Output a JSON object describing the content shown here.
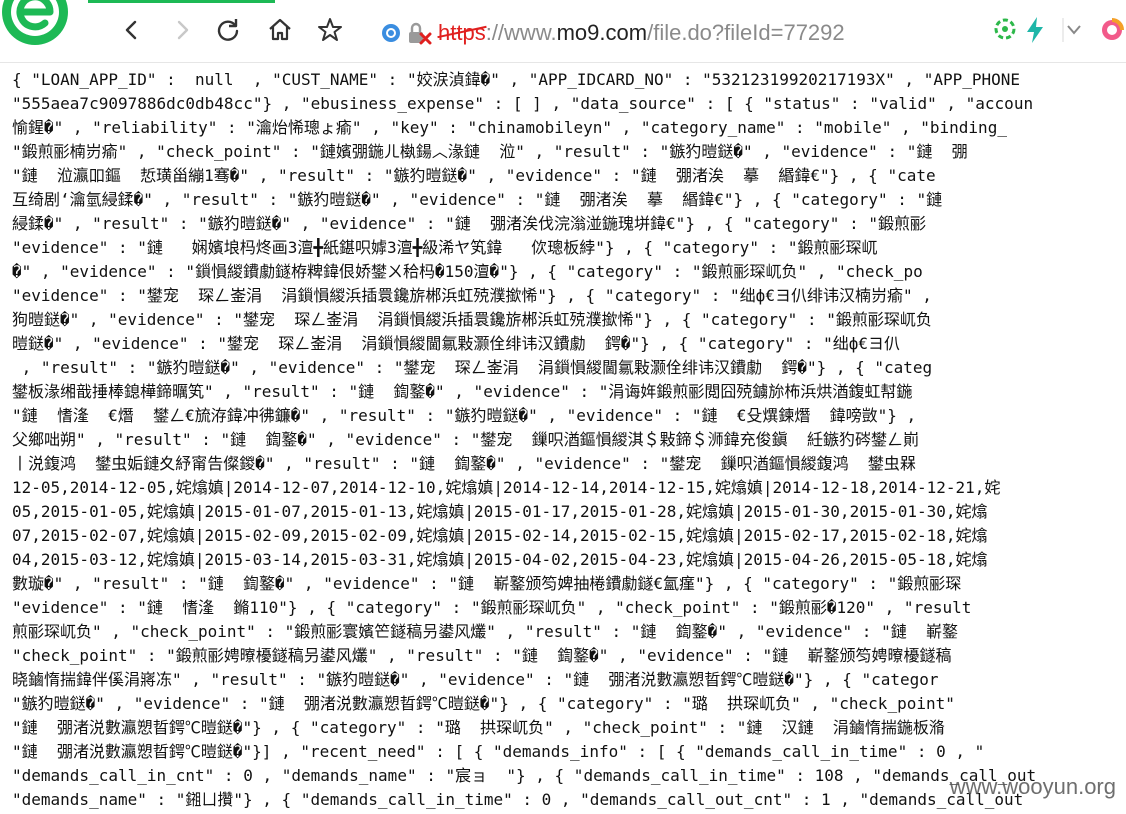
{
  "browser": {
    "url_scheme": "https",
    "url_separator": "://",
    "url_prefix": "www.",
    "url_host": "mo9.com",
    "url_path": "/file.do?fileId=77292",
    "progress_fraction": 0.18
  },
  "colors": {
    "brand_green": "#1db955",
    "insecure_red": "#e0201f",
    "page_text": "#111111"
  },
  "icons": {
    "logo": "browser-logo",
    "back": "back-arrow-icon",
    "forward": "forward-arrow-icon",
    "reload": "reload-icon",
    "home": "home-icon",
    "favorite": "star-icon",
    "site_info": "site-info-icon",
    "security": "insecure-lock-icon",
    "compat": "compat-mode-icon",
    "speed": "lightning-icon",
    "dropdown": "chevron-down-icon",
    "extension": "extension-icon"
  },
  "page": {
    "lines": [
      "{ \"LOAN_APP_ID\" :  null  , \"CUST_NAME\" : \"姣涙湞鍏�\" , \"APP_IDCARD_NO\" : \"53212319920217193X\" , \"APP_PHONE",
      "\"555aea7c9097886dc0db48cc\"} , \"ebusiness_expense\" : [ ] , \"data_source\" : [ { \"status\" : \"valid\" , \"accoun",
      "愉鍟�\" , \"reliability\" : \"瀹炲悕璁ょ瘉\" , \"key\" : \"chinamobileyn\" , \"category_name\" : \"mobile\" , \"binding_",
      "\"鍛煎彨楠岃瘉\" , \"check_point\" : \"鏈嬪弸鍦ㄦ槸鍚︿湪鏈  涖\" , \"result\" : \"鏃犳暟鎹�\" , \"evidence\" : \"鏈  弸",
      "\"鏈  涖瀛吅鏂  悊璜甾繃1骞�\" , \"result\" : \"鏃犳暟鎹�\" , \"evidence\" : \"鏈  弸渚涘  摹  緡鍏€\"} , { \"cate",
      "互绮剧‘瀹氫綅鍒�\" , \"result\" : \"鏃犳暟鎹�\" , \"evidence\" : \"鏈  弸渚涘  摹  緡鍏€\"} , { \"category\" : \"鏈",
      "綅鍒�\" , \"result\" : \"鏃犳暟鎹�\" , \"evidence\" : \"鏈  弸渚涘伐浣滃湴鍦瑰垪鍏€\"} , { \"category\" : \"鍛煎彨",
      "\"evidence\" : \"鏈   娴嬪埌杩炵画3澶╋紙鍖呮嫭3澶╋級浠ヤ笂鍏   佽璁板綍\"} , { \"category\" : \"鍛煎彨琛屼",
      "�\" , \"evidence\" : \"鎻愪緵鐨勮鐩栫粺鍏佷娇鐢ㄨ秴杩�150澶�\"} , { \"category\" : \"鍛煎彨琛屼负\" , \"check_po",
      "\"evidence\" : \"鐢宠  琛ㄥ崟涓  涓鎻愪緵浜插睘鑱旂郴浜虹殑濮撳悕\"} , { \"category\" : \"绌ф€ヨ仈绯讳汉楠岃瘉\" ,",
      "狗暟鎹�\" , \"evidence\" : \"鐢宠  琛ㄥ崟涓  涓鎻愪緵浜插睘鑱旂郴浜虹殑濮撳悕\"} , { \"category\" : \"鍛煎彨琛屼负",
      "暟鎹�\" , \"evidence\" : \"鐢宠  琛ㄥ崟涓  涓鎻愪緵閫氱敤灏佺绯讳汉鐨勮  鍔�\"} , { \"category\" : \"绌ф€ヨ仈",
      " , \"result\" : \"鏃犳暟鎹�\" , \"evidence\" : \"鐢宠  琛ㄥ崟涓  涓鎻愪緵閫氱敤灏佺绯讳汉鐨勮  鍔�\"} , { \"categ",
      "鐢板湪缃戠捶棒鎴樺鍗曞笂\" , \"result\" : \"鏈  鍧鐜�\" , \"evidence\" : \"涓诲姩鍛煎彨閲囧殑鐪旀柨浜烘湭鍑虹幇鍦",
      "\"鏈  愭湰  €熸  鐢ㄥ€旈洊鍏冲彿鐮�\" , \"result\" : \"鏃犳暟鎹�\" , \"evidence\" : \"鏈  €殳熼鍊熸  鍏嗙敳\"} ,",
      "父鄉咄朔\" , \"result\" : \"鏈  鍧鐜�\" , \"evidence\" : \"鐢宠  鏁呮湭鏂愪緵淇＄敤鍗＄浉鍏充俊鎭  紝鏃犳硶鐢ㄥ崱",
      "丨涚鍑鸿  鐢虫姤鏈夊紓甯告儏鍐�\" , \"result\" : \"鏈  鍧鐜�\" , \"evidence\" : \"鐢宠  鏁呮湭鏂愪緵鍑鸿  鐢虫槑",
      "12-05,2014-12-05,姹熻嫃|2014-12-07,2014-12-10,姹熻嫃|2014-12-14,2014-12-15,姹熻嫃|2014-12-18,2014-12-21,姹",
      "05,2015-01-05,姹熻嫃|2015-01-07,2015-01-13,姹熻嫃|2015-01-17,2015-01-28,姹熻嫃|2015-01-30,2015-01-30,姹熻",
      "07,2015-02-07,姹熻嫃|2015-02-09,2015-02-09,姹熻嫃|2015-02-14,2015-02-15,姹熻嫃|2015-02-17,2015-02-18,姹熻",
      "04,2015-03-12,姹熻嫃|2015-03-14,2015-03-31,姹熻嫃|2015-04-02,2015-04-23,姹熻嫃|2015-04-26,2015-05-18,姹熻",
      "數璇�\" , \"result\" : \"鏈  鍧鐜�\" , \"evidence\" : \"鏈  嶄鐜颁笉婢抽棬鐨勮鐩€氳瘽\"} , { \"category\" : \"鍛煎彨琛",
      "\"evidence\" : \"鏈  愭湰  鏅110\"} , { \"category\" : \"鍛煎彨琛屼负\" , \"check_point\" : \"鍛煎彨�120\" , \"result",
      "煎彨琛屼负\" , \"check_point\" : \"鍛煎彨寰嬪笀鐩稿叧鍙风爜\" , \"result\" : \"鏈  鍧鐜�\" , \"evidence\" : \"鏈  嶄鐜",
      "\"check_point\" : \"鍛煎彨娉曢櫌鐩稿叧鍙风爜\" , \"result\" : \"鏈  鍧鐜�\" , \"evidence\" : \"鏈  嶄鐜颁笉娉曢櫌鐩稿",
      "晓鏀惰揣鍏伴傒涓嶈冻\" , \"result\" : \"鏃犳暟鎹�\" , \"evidence\" : \"鏈  弸渚涚數瀛愬晢鍔℃暟鎹�\"} , { \"categor",
      "\"鏃犳暟鎹�\" , \"evidence\" : \"鏈  弸渚涚數瀛愬晢鍔℃暟鎹�\"} , { \"category\" : \"璐  拱琛屼负\" , \"check_point\"",
      "\"鏈  弸渚涚數瀛愬晢鍔℃暟鎹�\"} , { \"category\" : \"璐  拱琛屼负\" , \"check_point\" : \"鏈  汉鏈  涓鏀惰揣鍦板潃",
      "\"鏈  弸渚涚數瀛愬晢鍔℃暟鎹�\"}] , \"recent_need\" : [ { \"demands_info\" : [ { \"demands_call_in_time\" : 0 , \"",
      "\"demands_call_in_cnt\" : 0 , \"demands_name\" : \"宸ョ  \"} , { \"demands_call_in_time\" : 108 , \"demands_call_out",
      "\"demands_name\" : \"鎺ㄩ攢\"} , { \"demands_call_in_time\" : 0 , \"demands_call_out_cnt\" : 1 , \"demands_call_out",
      "灏涗紝惓\" , { \"demands_call_in_time\" : 25129 , \"demands_call_out_cnt\" : 196 , \"demands_call_out_time\" : 1"
    ]
  },
  "watermark": "www.wooyun.org"
}
